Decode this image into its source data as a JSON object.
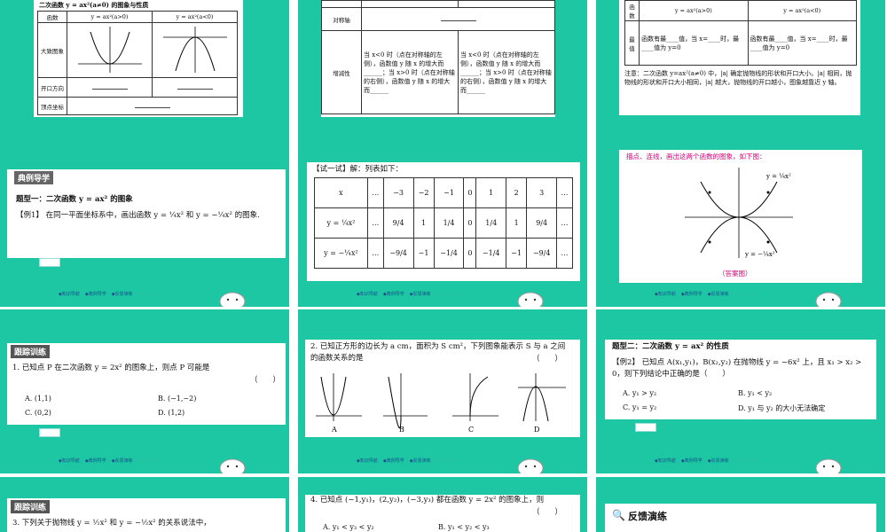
{
  "footer": [
    "◆知识导航",
    "◆典例导学",
    "◆反馈演练"
  ],
  "footer_dim": [
    "·····",
    "·····"
  ],
  "s1": {
    "title": "二次函数 y = ax²(a≠0) 的图象与性质",
    "col_fn": "函数",
    "col_a_pos": "y = ax²(a>0)",
    "col_a_neg": "y = ax²(a<0)",
    "row_graph": "大致图象",
    "row_dir": "开口方向",
    "row_vertex": "顶点坐标"
  },
  "s2": {
    "row_axis": "对称轴",
    "row_mono": "增减性",
    "mono_left": "当 x<0 时（点在对称轴的左侧），函数值 y 随 x 的增大而______；当 x>0 时（点在对称轴的右侧），函数值 y 随 x 的增大而______",
    "mono_right": "当 x<0 时（点在对称轴的左侧），函数值 y 随 x 的增大而______；当 x>0 时（点在对称轴的右侧），函数值 y 随 x 的增大而______"
  },
  "s3": {
    "col_1": "函数",
    "col_a": "y = ax²(a>0)",
    "col_b": "y = ax²(a<0)",
    "row_max": "最值",
    "cell_a": "函数有最____值，当 x=____时，最____值为 y=0",
    "cell_b": "函数有最____值，当 x=____时，最____值为 y=0",
    "note": "注意：二次函数 y=ax²(a≠0) 中，|a| 确定抛物线的形状和开口大小。|a| 相同，抛物线的形状和开口大小相同，|a| 越大，抛物线的开口越小，图象越靠近 y 轴。"
  },
  "s4": {
    "header": "典例导学",
    "type1": "题型一：二次函数 y = ax² 的图象",
    "ex1": "【例1】 在同一平面坐标系中，画出函数 y = ¼x² 和 y = −¼x² 的图象."
  },
  "s5": {
    "title": "【试一试】解：列表如下：",
    "row_x": [
      "x",
      "…",
      "−3",
      "−2",
      "−1",
      "0",
      "1",
      "2",
      "3",
      "…"
    ],
    "row_pos": [
      "y = ¼x²",
      "…",
      "9/4",
      "1",
      "1/4",
      "0",
      "1/4",
      "1",
      "9/4",
      "…"
    ],
    "row_neg": [
      "y = −¼x²",
      "…",
      "−9/4",
      "−1",
      "−1/4",
      "0",
      "−1/4",
      "−1",
      "−9/4",
      "…"
    ]
  },
  "s6": {
    "desc": "描点、连线，画出这两个函数的图象，如下图：",
    "lbl_pos": "y = ¼x²",
    "lbl_neg": "y = −¼x²",
    "caption": "（答案图）"
  },
  "s7": {
    "header": "跟踪训练",
    "q": "1. 已知点 P 在二次函数 y = 2x² 的图象上，则点 P 可能是",
    "paren": "（　　）",
    "A": "A. (1,1)",
    "B": "B. (−1,−2)",
    "C": "C. (0,2)",
    "D": "D. (1,2)"
  },
  "s8": {
    "q": "2. 已知正方形的边长为 a cm，面积为 S cm²，下列图象能表示 S 与 a 之间的函数关系的是",
    "paren": "（　　）",
    "labels": [
      "A",
      "B",
      "C",
      "D"
    ]
  },
  "s9": {
    "type2": "题型二：二次函数 y = ax² 的性质",
    "ex2": "【例2】 已知点 A(x₁,y₁)，B(x₂,y₂) 在抛物线 y = −6x² 上，且 x₁ > x₂ > 0，则下列结论中正确的是（　　）",
    "A": "A. y₁ > y₂",
    "B": "B. y₁ < y₂",
    "C": "C. y₁ = y₂",
    "D": "D. y₁ 与 y₂ 的大小无法确定"
  },
  "s10": {
    "header": "跟踪训练",
    "q": "3. 下列关于抛物线 y = ½x² 和 y = −½x² 的关系说法中，"
  },
  "s11": {
    "q": "4. 已知点 (−1,y₁)，(2,y₂)，(−3,y₃) 都在函数 y = 2x² 的图象上，则",
    "paren": "（　　）",
    "A": "A. y₁ < y₃ < y₂",
    "B": "B. y₁ < y₂ < y₃"
  },
  "s12": {
    "header": "反馈演练"
  }
}
